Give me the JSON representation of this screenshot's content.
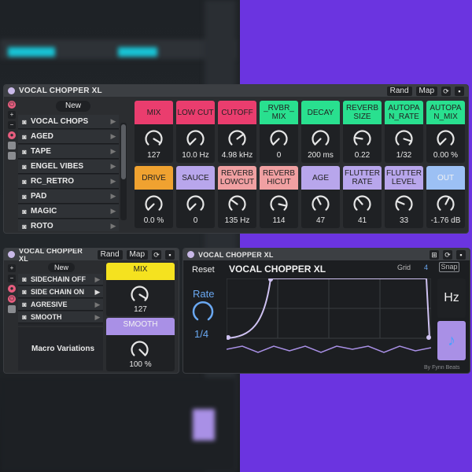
{
  "colors": {
    "pink": "#ea3d6e",
    "green": "#29e08f",
    "orange": "#f0a230",
    "lavender": "#b8a6ec",
    "salmon": "#f0a0a2",
    "blue": "#9cc0f4",
    "yellow": "#f5e21f",
    "purple_bg": "#6b34e0",
    "accent_blue": "#6aa8f2"
  },
  "main": {
    "title": "VOCAL CHOPPER XL",
    "rand_label": "Rand",
    "map_label": "Map",
    "new_label": "New",
    "presets": [
      "VOCAL CHOPS",
      "AGED",
      "TAPE",
      "ENGEL VIBES",
      "RC_RETRO",
      "PAD",
      "MAGIC",
      "ROTO"
    ],
    "params": [
      {
        "label": "MIX",
        "value": "127",
        "color": "pink",
        "white": false,
        "level": 0.95
      },
      {
        "label": "LOW CUT",
        "value": "10.0 Hz",
        "color": "pink",
        "white": false,
        "level": 0.0
      },
      {
        "label": "CUTOFF",
        "value": "4.98 kHz",
        "color": "pink",
        "white": false,
        "level": 0.7
      },
      {
        "label": "_RVBR_ MIX",
        "value": "0",
        "color": "green",
        "white": false,
        "level": 0.0
      },
      {
        "label": "DECAY",
        "value": "200 ms",
        "color": "green",
        "white": false,
        "level": 0.0
      },
      {
        "label": "REVERB SIZE",
        "value": "0.22",
        "color": "green",
        "white": false,
        "level": 0.2
      },
      {
        "label": "AUTOPA N_RATE",
        "value": "1/32",
        "color": "green",
        "white": false,
        "level": 0.9
      },
      {
        "label": "AUTOPA N_MIX",
        "value": "0.00 %",
        "color": "green",
        "white": false,
        "level": 0.0
      },
      {
        "label": "DRIVE",
        "value": "0.0 %",
        "color": "orange",
        "white": false,
        "level": 0.0
      },
      {
        "label": "SAUCE",
        "value": "0",
        "color": "lavender",
        "white": false,
        "level": 0.0
      },
      {
        "label": "REVERB LOWCUT",
        "value": "135 Hz",
        "color": "salmon",
        "white": false,
        "level": 0.3
      },
      {
        "label": "REVERB HICUT",
        "value": "114",
        "color": "salmon",
        "white": false,
        "level": 0.88
      },
      {
        "label": "AGE",
        "value": "47",
        "color": "lavender",
        "white": false,
        "level": 0.4
      },
      {
        "label": "FLUTTER RATE",
        "value": "41",
        "color": "lavender",
        "white": false,
        "level": 0.35
      },
      {
        "label": "FLUTTER LEVEL",
        "value": "33",
        "color": "lavender",
        "white": false,
        "level": 0.25
      },
      {
        "label": "OUT",
        "value": "-1.76 dB",
        "color": "blue",
        "white": true,
        "level": 0.6
      }
    ]
  },
  "macro": {
    "title": "VOCAL CHOPPER XL",
    "rand_label": "Rand",
    "map_label": "Map",
    "new_label": "New",
    "presets": [
      "SIDECHAIN OFF",
      "SIDE CHAIN ON",
      "AGRESIVE",
      "SMOOTH"
    ],
    "variations_label": "Macro Variations",
    "mix_label": "MIX",
    "mix_value": "127",
    "smooth_label": "SMOOTH",
    "smooth_value": "100 %"
  },
  "env": {
    "titlebar": "VOCAL CHOPPER XL",
    "heading": "VOCAL CHOPPER XL",
    "reset_label": "Reset",
    "rate_label": "Rate",
    "rate_value": "1/4",
    "grid_label": "Grid",
    "grid_value": "4",
    "snap_label": "Snap",
    "hz_label": "Hz",
    "note_icon": "note-icon",
    "credit": "By Fynn Beats"
  }
}
